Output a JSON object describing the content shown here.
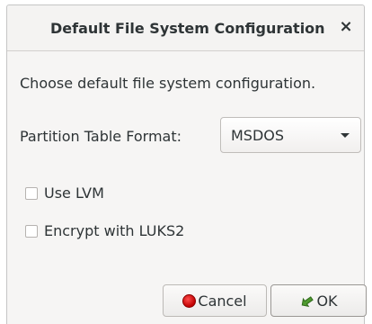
{
  "dialog": {
    "title": "Default File System Configuration",
    "close_glyph": "×",
    "description": "Choose default file system configuration.",
    "partition_table": {
      "label": "Partition Table Format:",
      "selected": "MSDOS"
    },
    "options": {
      "use_lvm": {
        "label": "Use LVM",
        "checked": false
      },
      "encrypt_luks2": {
        "label": "Encrypt with LUKS2",
        "checked": false
      }
    },
    "buttons": {
      "cancel": {
        "label": "Cancel",
        "icon": "stop-icon"
      },
      "ok": {
        "label": "OK",
        "icon": "checkmark-arrow-icon"
      }
    },
    "colors": {
      "cancel_icon": "#d40000",
      "ok_icon": "#3a7a2a"
    }
  }
}
